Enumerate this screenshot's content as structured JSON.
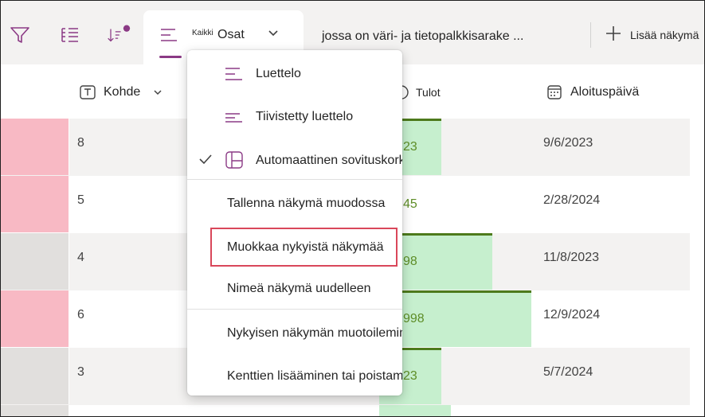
{
  "colors": {
    "accent": "#8b3a85",
    "pink": "#f8b9c4",
    "grey": "#e1dfdd",
    "bar_green": "#c6efce",
    "bar_line": "#4d7a1c",
    "money_text": "#5e8d27",
    "highlight": "#d9475a"
  },
  "toolbar": {
    "filter_icon": "filter-icon",
    "group_icon": "group-by-icon",
    "sort_icon": "sort-icon",
    "active_view": {
      "icon": "list-view-icon",
      "small_label": "Kaikki",
      "label": "Osat",
      "chevron": "chevron-down-icon"
    },
    "second_view_label": "jossa on väri- ja tietopalkkisarake ...",
    "add_view_label": "Lisää näkymä"
  },
  "columns": {
    "kohde": "Kohde",
    "tulot": "Tulot",
    "aloituspaiva": "Aloituspäivä"
  },
  "rows": [
    {
      "color": "pink",
      "num": "8",
      "money": "23",
      "date": "9/6/2023",
      "bar_fill": 0.27
    },
    {
      "color": "pink",
      "num": "5",
      "money": "45",
      "date": "2/28/2024",
      "bar_fill": 0.0
    },
    {
      "color": "grey",
      "num": "4",
      "money": "98",
      "date": "11/8/2023",
      "bar_fill": 0.49
    },
    {
      "color": "pink",
      "num": "6",
      "money": "998",
      "date": "12/9/2024",
      "bar_fill": 0.66
    },
    {
      "color": "grey",
      "num": "3",
      "money": "23",
      "date": "5/7/2024",
      "bar_fill": 0.27
    }
  ],
  "menu": {
    "luettelo": "Luettelo",
    "tiivistetty": "Tiivistetty luettelo",
    "automaattinen": "Automaattinen sovituskorkeus",
    "tallenna": "Tallenna näkymä muodossa",
    "muokkaa": "Muokkaa nykyistä näkymää",
    "nimea": "Nimeä näkymä uudelleen",
    "muotoile": "Nykyisen näkymän muotoileminen",
    "kentat": "Kenttien lisääminen tai poistaminen"
  }
}
